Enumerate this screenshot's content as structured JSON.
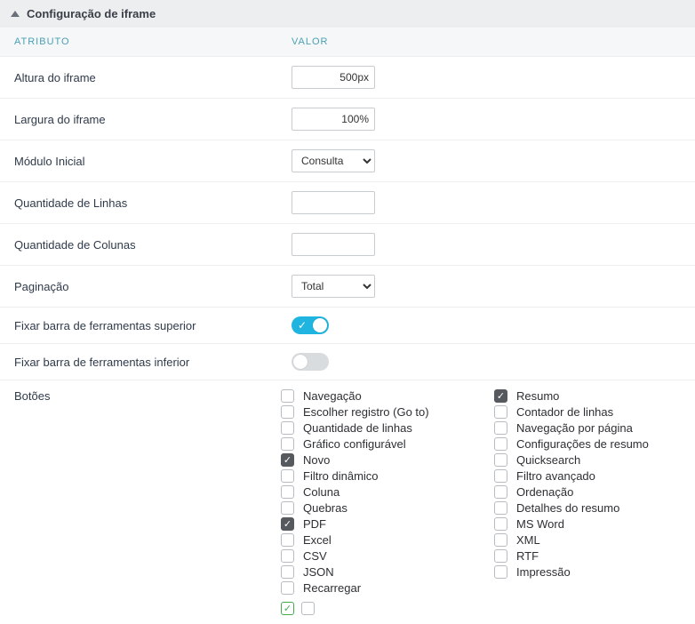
{
  "panel": {
    "title": "Configuração de iframe"
  },
  "columns": {
    "attr": "ATRIBUTO",
    "val": "VALOR"
  },
  "rows": {
    "height": {
      "label": "Altura do iframe",
      "value": "500px"
    },
    "width": {
      "label": "Largura do iframe",
      "value": "100%"
    },
    "module": {
      "label": "Módulo Inicial",
      "value": "Consulta"
    },
    "lines": {
      "label": "Quantidade de Linhas",
      "value": ""
    },
    "cols": {
      "label": "Quantidade de Colunas",
      "value": ""
    },
    "paging": {
      "label": "Paginação",
      "value": "Total"
    },
    "fix_top": {
      "label": "Fixar barra de ferramentas superior",
      "on": true
    },
    "fix_bot": {
      "label": "Fixar barra de ferramentas inferior",
      "on": false
    },
    "buttons": {
      "label": "Botões"
    }
  },
  "buttons_left": [
    {
      "label": "Navegação",
      "checked": false
    },
    {
      "label": "Escolher registro (Go to)",
      "checked": false
    },
    {
      "label": "Quantidade de linhas",
      "checked": false
    },
    {
      "label": "Gráfico configurável",
      "checked": false
    },
    {
      "label": "Novo",
      "checked": true
    },
    {
      "label": "Filtro dinâmico",
      "checked": false
    },
    {
      "label": "Coluna",
      "checked": false
    },
    {
      "label": "Quebras",
      "checked": false
    },
    {
      "label": "PDF",
      "checked": true
    },
    {
      "label": "Excel",
      "checked": false
    },
    {
      "label": "CSV",
      "checked": false
    },
    {
      "label": "JSON",
      "checked": false
    },
    {
      "label": "Recarregar",
      "checked": false
    }
  ],
  "buttons_right": [
    {
      "label": "Resumo",
      "checked": true
    },
    {
      "label": "Contador de linhas",
      "checked": false
    },
    {
      "label": "Navegação por página",
      "checked": false
    },
    {
      "label": "Configurações de resumo",
      "checked": false
    },
    {
      "label": "Quicksearch",
      "checked": false
    },
    {
      "label": "Filtro avançado",
      "checked": false
    },
    {
      "label": "Ordenação",
      "checked": false
    },
    {
      "label": "Detalhes do resumo",
      "checked": false
    },
    {
      "label": "MS Word",
      "checked": false
    },
    {
      "label": "XML",
      "checked": false
    },
    {
      "label": "RTF",
      "checked": false
    },
    {
      "label": "Impressão",
      "checked": false
    }
  ],
  "footer_checks": [
    {
      "checked": true,
      "green": true
    },
    {
      "checked": false,
      "green": false
    }
  ]
}
